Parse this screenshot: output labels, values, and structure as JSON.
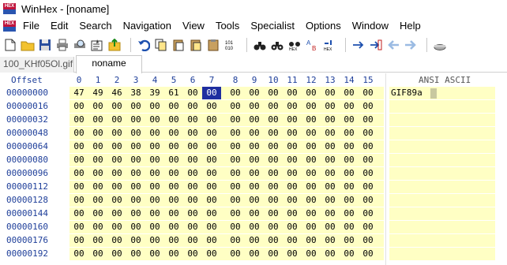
{
  "window": {
    "title": "WinHex - [noname]",
    "logo_text": "HEX"
  },
  "menu": {
    "items": [
      "File",
      "Edit",
      "Search",
      "Navigation",
      "View",
      "Tools",
      "Specialist",
      "Options",
      "Window",
      "Help"
    ]
  },
  "toolbar": {
    "buttons": [
      "new-file-icon",
      "open-folder-icon",
      "save-icon",
      "print-icon",
      "print-preview-icon",
      "properties-icon",
      "export-icon",
      "undo-icon",
      "copy-icon",
      "paste-icon",
      "paste-special-icon",
      "clipboard-icon",
      "binary-icon",
      "find-icon",
      "find-again-icon",
      "find-hex-icon",
      "replace-icon",
      "replace-hex-icon",
      "goto-offset-icon",
      "goto-end-icon",
      "back-icon",
      "forward-icon",
      "disk-icon"
    ],
    "binary_label": "101 010",
    "hex_label": "HEX"
  },
  "tabs": [
    {
      "label": "100_KHf05Ol.gif",
      "active": false
    },
    {
      "label": "noname",
      "active": true
    }
  ],
  "editor": {
    "offset_header": "Offset",
    "ansi_header": "ANSI ASCII",
    "columns": [
      "0",
      "1",
      "2",
      "3",
      "4",
      "5",
      "6",
      "7",
      "8",
      "9",
      "10",
      "11",
      "12",
      "13",
      "14",
      "15"
    ],
    "cursor": {
      "row": 0,
      "col": 7
    },
    "rows": [
      {
        "offset": "00000000",
        "bytes": [
          "47",
          "49",
          "46",
          "38",
          "39",
          "61",
          "00",
          "00",
          "00",
          "00",
          "00",
          "00",
          "00",
          "00",
          "00",
          "00"
        ],
        "ansi": "GIF89a"
      },
      {
        "offset": "00000016",
        "bytes": [
          "00",
          "00",
          "00",
          "00",
          "00",
          "00",
          "00",
          "00",
          "00",
          "00",
          "00",
          "00",
          "00",
          "00",
          "00",
          "00"
        ],
        "ansi": ""
      },
      {
        "offset": "00000032",
        "bytes": [
          "00",
          "00",
          "00",
          "00",
          "00",
          "00",
          "00",
          "00",
          "00",
          "00",
          "00",
          "00",
          "00",
          "00",
          "00",
          "00"
        ],
        "ansi": ""
      },
      {
        "offset": "00000048",
        "bytes": [
          "00",
          "00",
          "00",
          "00",
          "00",
          "00",
          "00",
          "00",
          "00",
          "00",
          "00",
          "00",
          "00",
          "00",
          "00",
          "00"
        ],
        "ansi": ""
      },
      {
        "offset": "00000064",
        "bytes": [
          "00",
          "00",
          "00",
          "00",
          "00",
          "00",
          "00",
          "00",
          "00",
          "00",
          "00",
          "00",
          "00",
          "00",
          "00",
          "00"
        ],
        "ansi": ""
      },
      {
        "offset": "00000080",
        "bytes": [
          "00",
          "00",
          "00",
          "00",
          "00",
          "00",
          "00",
          "00",
          "00",
          "00",
          "00",
          "00",
          "00",
          "00",
          "00",
          "00"
        ],
        "ansi": ""
      },
      {
        "offset": "00000096",
        "bytes": [
          "00",
          "00",
          "00",
          "00",
          "00",
          "00",
          "00",
          "00",
          "00",
          "00",
          "00",
          "00",
          "00",
          "00",
          "00",
          "00"
        ],
        "ansi": ""
      },
      {
        "offset": "00000112",
        "bytes": [
          "00",
          "00",
          "00",
          "00",
          "00",
          "00",
          "00",
          "00",
          "00",
          "00",
          "00",
          "00",
          "00",
          "00",
          "00",
          "00"
        ],
        "ansi": ""
      },
      {
        "offset": "00000128",
        "bytes": [
          "00",
          "00",
          "00",
          "00",
          "00",
          "00",
          "00",
          "00",
          "00",
          "00",
          "00",
          "00",
          "00",
          "00",
          "00",
          "00"
        ],
        "ansi": ""
      },
      {
        "offset": "00000144",
        "bytes": [
          "00",
          "00",
          "00",
          "00",
          "00",
          "00",
          "00",
          "00",
          "00",
          "00",
          "00",
          "00",
          "00",
          "00",
          "00",
          "00"
        ],
        "ansi": ""
      },
      {
        "offset": "00000160",
        "bytes": [
          "00",
          "00",
          "00",
          "00",
          "00",
          "00",
          "00",
          "00",
          "00",
          "00",
          "00",
          "00",
          "00",
          "00",
          "00",
          "00"
        ],
        "ansi": ""
      },
      {
        "offset": "00000176",
        "bytes": [
          "00",
          "00",
          "00",
          "00",
          "00",
          "00",
          "00",
          "00",
          "00",
          "00",
          "00",
          "00",
          "00",
          "00",
          "00",
          "00"
        ],
        "ansi": ""
      },
      {
        "offset": "00000192",
        "bytes": [
          "00",
          "00",
          "00",
          "00",
          "00",
          "00",
          "00",
          "00",
          "00",
          "00",
          "00",
          "00",
          "00",
          "00",
          "00",
          "00"
        ],
        "ansi": ""
      }
    ]
  }
}
